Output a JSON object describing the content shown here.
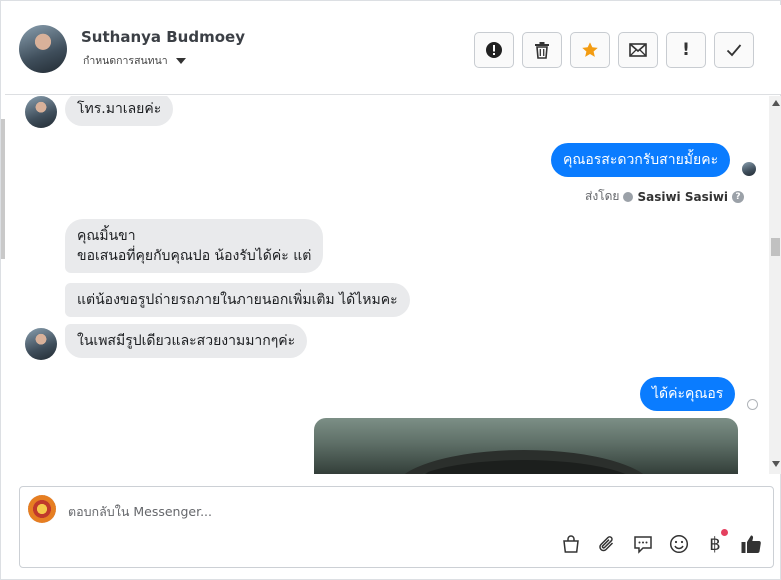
{
  "header": {
    "contact_name": "Suthanya Budmoey",
    "assign_label": "กำหนดการสนทนา",
    "actions": [
      {
        "name": "report-button",
        "icon": "alert-circle-icon"
      },
      {
        "name": "delete-button",
        "icon": "trash-icon"
      },
      {
        "name": "star-button",
        "icon": "star-icon"
      },
      {
        "name": "mark-unread-button",
        "icon": "envelope-icon"
      },
      {
        "name": "important-button",
        "icon": "exclamation-icon",
        "glyph": "!"
      },
      {
        "name": "mark-done-button",
        "icon": "checkmark-icon"
      }
    ],
    "star_color": "#f39c12"
  },
  "messages": [
    {
      "from": "contact",
      "text": "โทร.มาเลยค่ะ"
    },
    {
      "from": "page",
      "text": "คุณอรสะดวกรับสายมั้ยคะ",
      "sent_by_label": "ส่งโดย",
      "sent_by_name": "Sasiwi Sasiwi"
    },
    {
      "from": "contact",
      "lines": [
        "คุณมิ้นขา",
        "ขอเสนอที่คุยกับคุณปอ น้องรับได้ค่ะ แต่"
      ]
    },
    {
      "from": "contact",
      "text": "แต่น้องขอรูปถ่ายรถภายในภายนอกเพิ่มเติม ได้ไหมคะ"
    },
    {
      "from": "contact",
      "text": "ในเพสมีรูปเดียวและสวยงามมากๆค่ะ"
    },
    {
      "from": "page",
      "text": "ได้ค่ะคุณอร"
    },
    {
      "from": "page",
      "type": "photo"
    }
  ],
  "composer": {
    "placeholder": "ตอบกลับใน Messenger...",
    "tools": [
      "bag-icon",
      "paperclip-icon",
      "saved-reply-icon",
      "emoji-icon",
      "baht-payment-icon",
      "thumbs-up-icon"
    ],
    "baht_glyph": "฿"
  },
  "colors": {
    "outgoing_bubble": "#0a7cff",
    "incoming_bubble": "#e9eaec",
    "badge": "#e4405f"
  }
}
